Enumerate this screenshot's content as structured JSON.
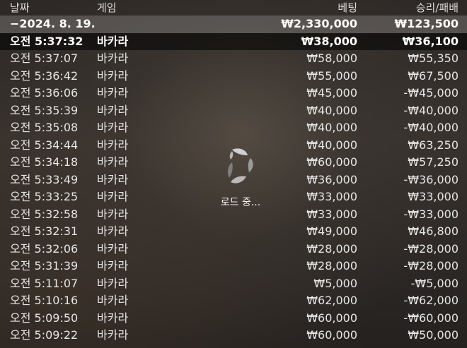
{
  "columns": {
    "date": "날짜",
    "game": "게임",
    "bet": "베팅",
    "result": "승리/패배"
  },
  "date_group": {
    "date": "−2024. 8. 19.",
    "bet": "₩2,330,000",
    "result": "₩123,500"
  },
  "rows": [
    {
      "time": "오전 5:37:32",
      "game": "바카라",
      "bet": "₩38,000",
      "result": "₩36,100"
    },
    {
      "time": "오전 5:37:07",
      "game": "바카라",
      "bet": "₩58,000",
      "result": "₩55,350"
    },
    {
      "time": "오전 5:36:42",
      "game": "바카라",
      "bet": "₩55,000",
      "result": "₩67,500"
    },
    {
      "time": "오전 5:36:06",
      "game": "바카라",
      "bet": "₩45,000",
      "result": "-₩45,000"
    },
    {
      "time": "오전 5:35:39",
      "game": "바카라",
      "bet": "₩40,000",
      "result": "-₩40,000"
    },
    {
      "time": "오전 5:35:08",
      "game": "바카라",
      "bet": "₩40,000",
      "result": "-₩40,000"
    },
    {
      "time": "오전 5:34:44",
      "game": "바카라",
      "bet": "₩40,000",
      "result": "₩63,250"
    },
    {
      "time": "오전 5:34:18",
      "game": "바카라",
      "bet": "₩60,000",
      "result": "₩57,250"
    },
    {
      "time": "오전 5:33:49",
      "game": "바카라",
      "bet": "₩36,000",
      "result": "-₩36,000"
    },
    {
      "time": "오전 5:33:25",
      "game": "바카라",
      "bet": "₩33,000",
      "result": "₩33,000"
    },
    {
      "time": "오전 5:32:58",
      "game": "바카라",
      "bet": "₩33,000",
      "result": "-₩33,000"
    },
    {
      "time": "오전 5:32:31",
      "game": "바카라",
      "bet": "₩49,000",
      "result": "₩46,800"
    },
    {
      "time": "오전 5:32:06",
      "game": "바카라",
      "bet": "₩28,000",
      "result": "-₩28,000"
    },
    {
      "time": "오전 5:31:39",
      "game": "바카라",
      "bet": "₩28,000",
      "result": "-₩28,000"
    },
    {
      "time": "오전 5:11:07",
      "game": "바카라",
      "bet": "₩5,000",
      "result": "-₩5,000"
    },
    {
      "time": "오전 5:10:16",
      "game": "바카라",
      "bet": "₩62,000",
      "result": "-₩62,000"
    },
    {
      "time": "오전 5:09:50",
      "game": "바카라",
      "bet": "₩60,000",
      "result": "-₩60,000"
    },
    {
      "time": "오전 5:09:22",
      "game": "바카라",
      "bet": "₩60,000",
      "result": "₩50,000"
    }
  ],
  "loader": {
    "label": "로드 중...",
    "icon": "loading-spinner-icon"
  }
}
